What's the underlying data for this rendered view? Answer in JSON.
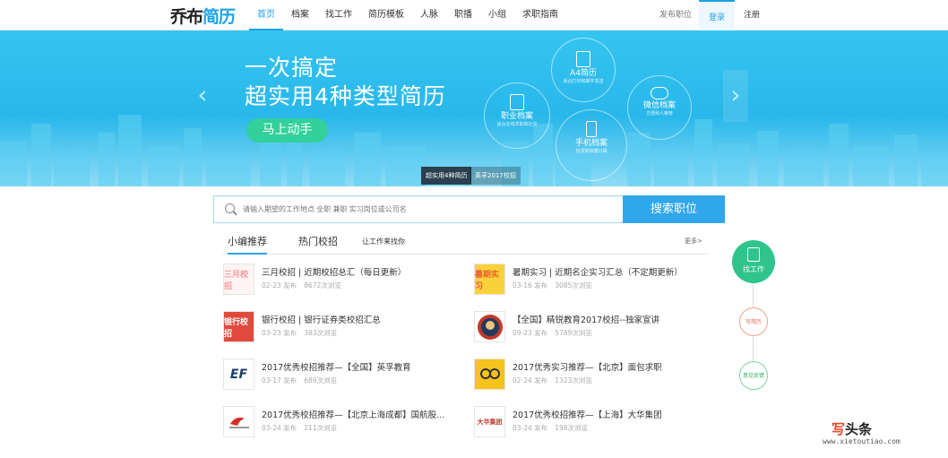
{
  "logo": {
    "part1": "乔布",
    "part2": "简历"
  },
  "nav": {
    "items": [
      {
        "label": "首页",
        "active": true
      },
      {
        "label": "档案"
      },
      {
        "label": "找工作"
      },
      {
        "label": "简历模板"
      },
      {
        "label": "人脉"
      },
      {
        "label": "职播"
      },
      {
        "label": "小组"
      },
      {
        "label": "求职指南"
      }
    ],
    "post_job": "发布职位",
    "login": "登录",
    "register": "注册"
  },
  "banner": {
    "headline1": "一次搞定",
    "headline2": "超实用4种类型简历",
    "cta": "马上动手",
    "circles": [
      {
        "title": "A4简历",
        "sub": "适合打印和邮件发送"
      },
      {
        "title": "职业档案",
        "sub": "适合在线求职和社交"
      },
      {
        "title": "微信档案",
        "sub": "方便熟人推荐"
      },
      {
        "title": "手机档案",
        "sub": "抢求职快捷口袋"
      }
    ],
    "chips": [
      "超实用4种简历",
      "英孚2017校招"
    ]
  },
  "search": {
    "placeholder": "请输入期望的工作地点 全职 兼职 实习岗位或公司名",
    "button": "搜索职位"
  },
  "tabs": {
    "items": [
      "小编推荐",
      "热门校招",
      "让工作来找你"
    ],
    "more": "更多>"
  },
  "list": [
    {
      "title": "三月校招 | 近期校招总汇（每日更新）",
      "date": "02-23 发布",
      "views": "8672次浏览",
      "thumb": "三月校招"
    },
    {
      "title": "暑期实习 | 近期名企实习汇总（不定期更新）",
      "date": "03-16 发布",
      "views": "3085次浏览",
      "thumb": "暑期实习"
    },
    {
      "title": "银行校招 | 银行证券类校招汇总",
      "date": "03-23 发布",
      "views": "383次浏览",
      "thumb": "银行校招"
    },
    {
      "title": "【全国】精锐教育2017校招--独家宣讲",
      "date": "09-23 发布",
      "views": "5789次浏览",
      "thumb": ""
    },
    {
      "title": "2017优秀校招推荐—【全国】英孚教育",
      "date": "03-17 发布",
      "views": "689次浏览",
      "thumb": "EF"
    },
    {
      "title": "2017优秀实习推荐—【北京】面包求职",
      "date": "02-24 发布",
      "views": "1323次浏览",
      "thumb": ""
    },
    {
      "title": "2017优秀校招推荐—【北京上海成都】国航股...",
      "date": "03-24 发布",
      "views": "211次浏览",
      "thumb": ""
    },
    {
      "title": "2017优秀校招推荐—【上海】大华集团",
      "date": "03-24 发布",
      "views": "198次浏览",
      "thumb": "大华集团"
    }
  ],
  "side": {
    "main": "找工作",
    "resume": "写简历",
    "feedback": "意见反馈"
  },
  "watermark": {
    "brand1": "写",
    "brand2": "头条",
    "url": "www.xietoutiao.com"
  },
  "colors": {
    "accent": "#1aa3e8",
    "banner": "#35c5f0",
    "cta": "#32d09a",
    "side": "#2fc48c"
  }
}
